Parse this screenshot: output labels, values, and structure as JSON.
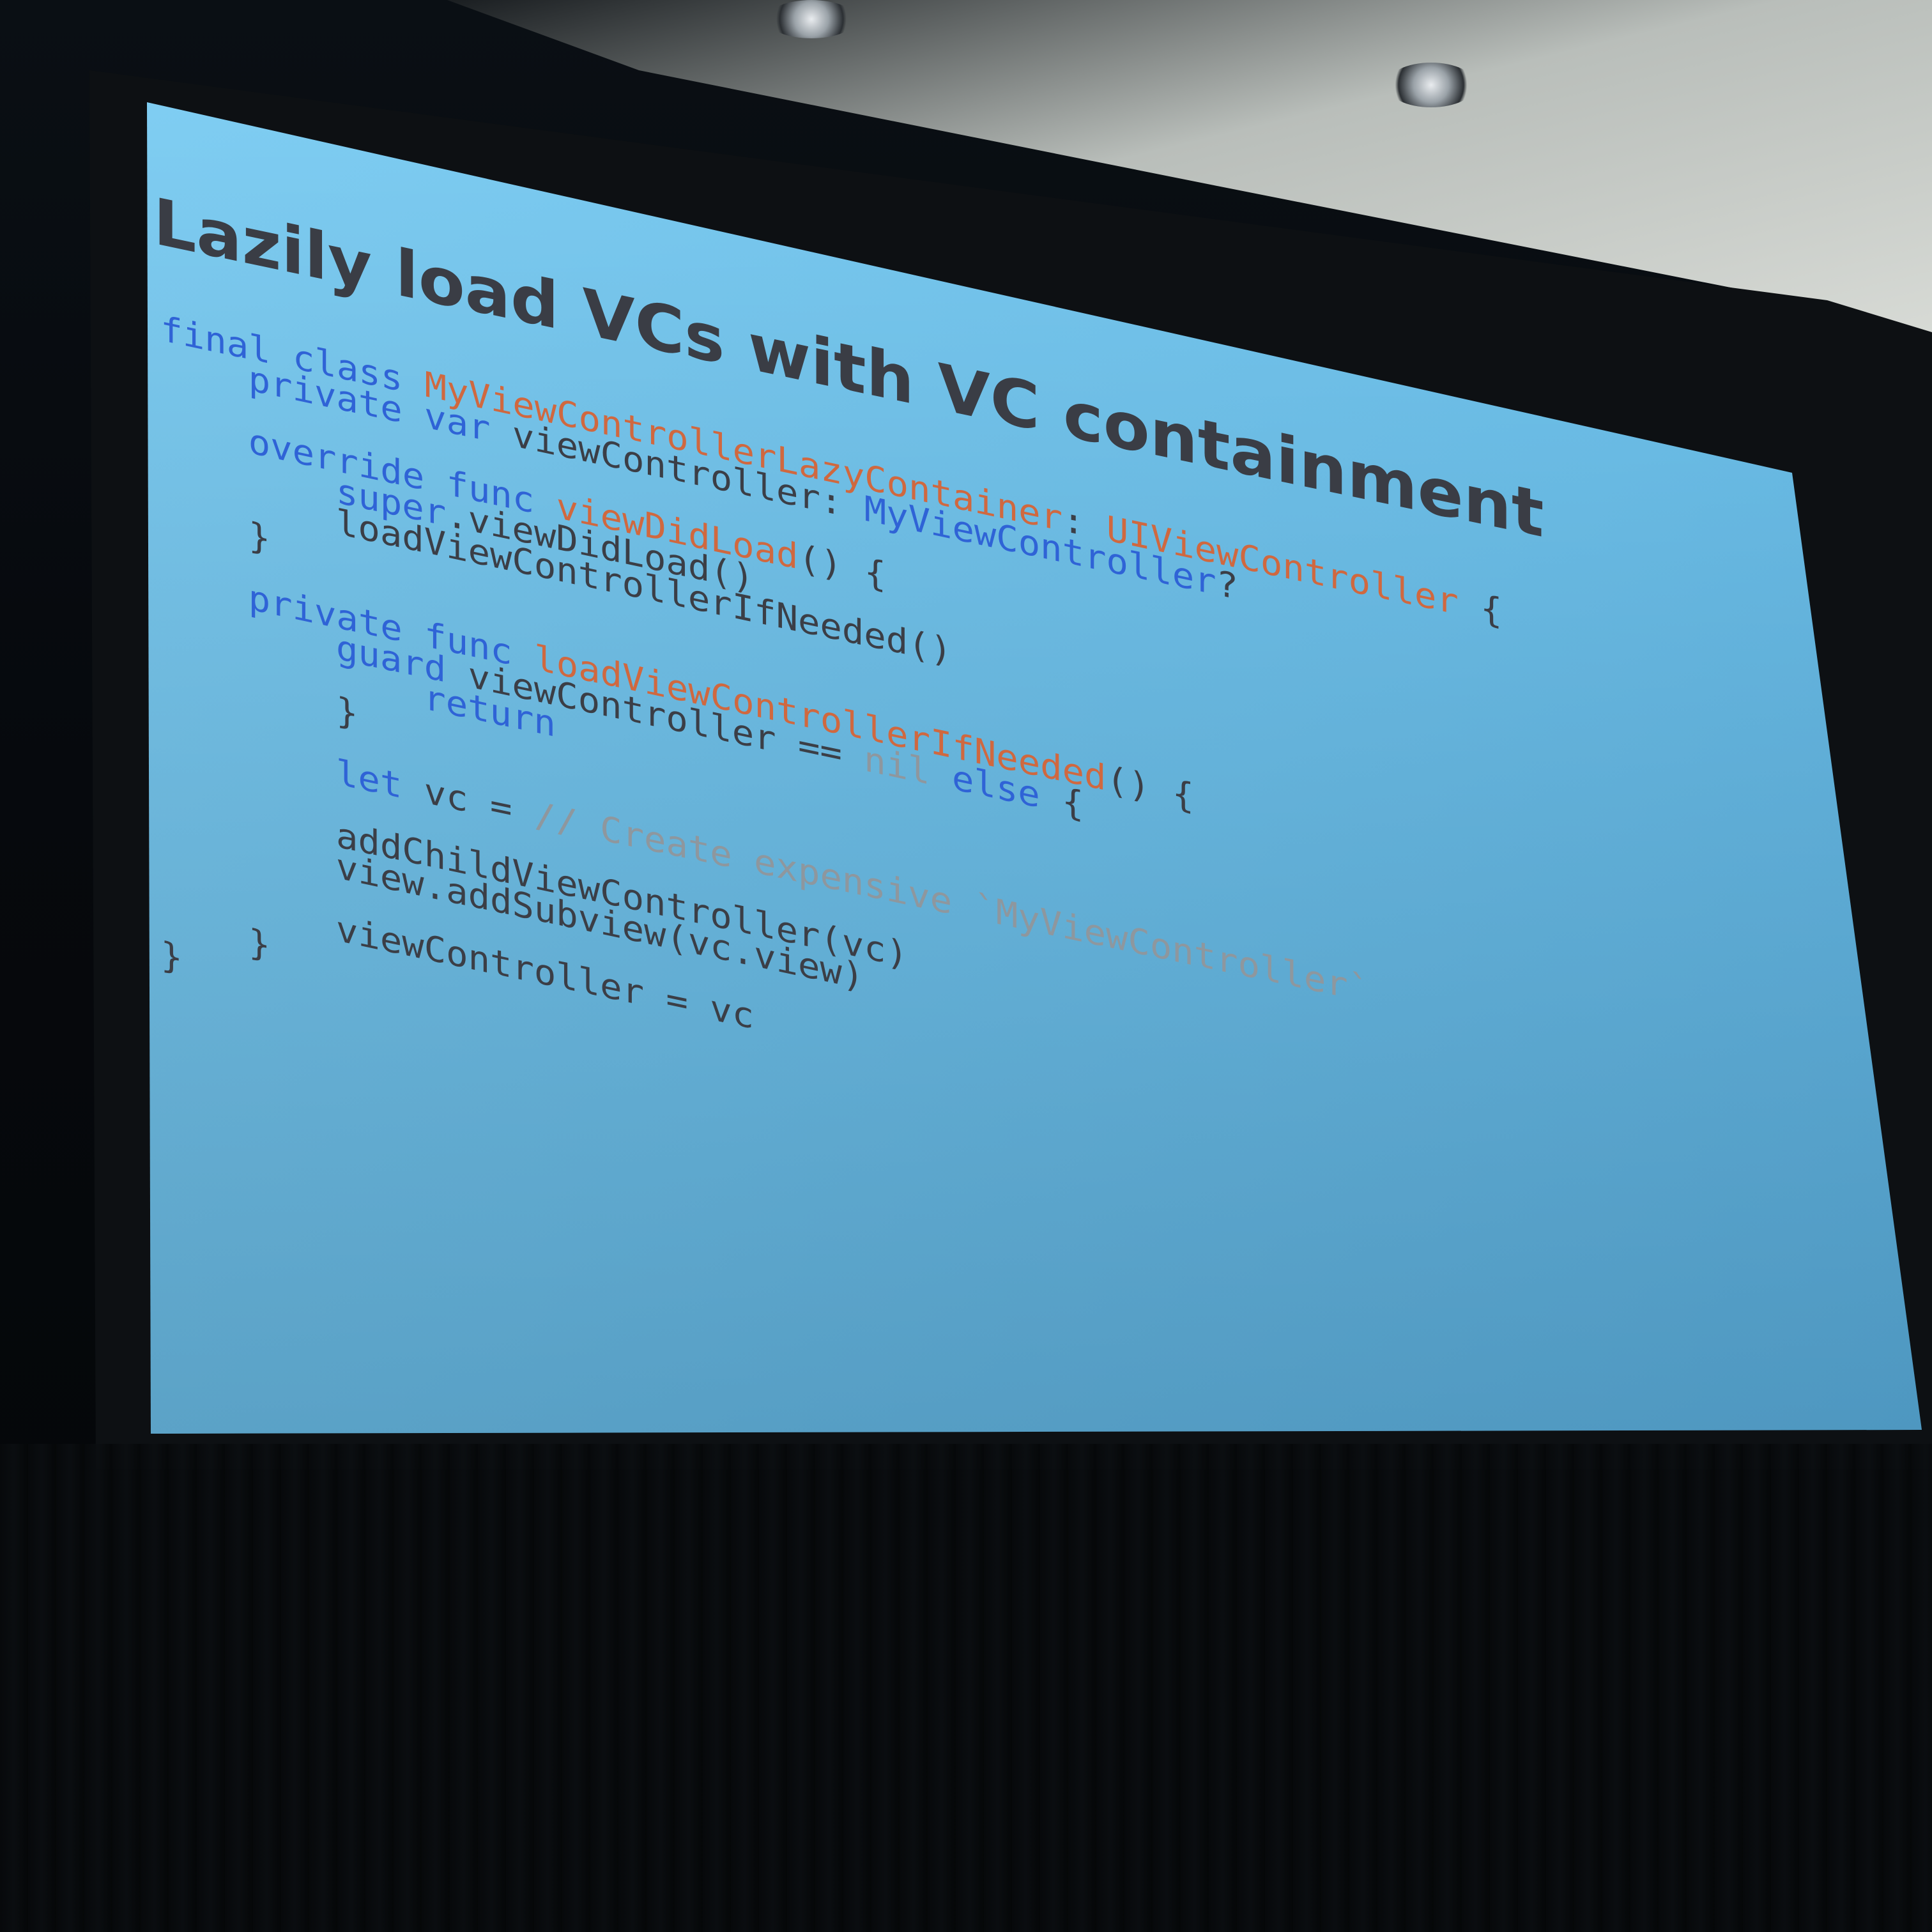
{
  "slide": {
    "title": "Lazily load VCs with VC containment",
    "code_lines": [
      {
        "indent": 0,
        "tokens": [
          {
            "t": "final class ",
            "c": "kw"
          },
          {
            "t": "MyViewControllerLazyContainer",
            "c": "type"
          },
          {
            "t": ": ",
            "c": "plain"
          },
          {
            "t": "UIViewController",
            "c": "type"
          },
          {
            "t": " {",
            "c": "plain"
          }
        ]
      },
      {
        "indent": 1,
        "tokens": [
          {
            "t": "private var ",
            "c": "kw"
          },
          {
            "t": "viewController: ",
            "c": "plain"
          },
          {
            "t": "MyViewController",
            "c": "kw"
          },
          {
            "t": "?",
            "c": "plain"
          }
        ]
      },
      {
        "indent": 0,
        "tokens": []
      },
      {
        "indent": 1,
        "tokens": [
          {
            "t": "override func ",
            "c": "kw"
          },
          {
            "t": "viewDidLoad",
            "c": "type"
          },
          {
            "t": "() {",
            "c": "plain"
          }
        ]
      },
      {
        "indent": 2,
        "tokens": [
          {
            "t": "super",
            "c": "kw"
          },
          {
            "t": ".viewDidLoad()",
            "c": "plain"
          }
        ]
      },
      {
        "indent": 2,
        "tokens": [
          {
            "t": "loadViewControllerIfNeeded()",
            "c": "plain"
          }
        ]
      },
      {
        "indent": 1,
        "tokens": [
          {
            "t": "}",
            "c": "plain"
          }
        ]
      },
      {
        "indent": 0,
        "tokens": []
      },
      {
        "indent": 1,
        "tokens": [
          {
            "t": "private func ",
            "c": "kw"
          },
          {
            "t": "loadViewControllerIfNeeded",
            "c": "type"
          },
          {
            "t": "() {",
            "c": "plain"
          }
        ]
      },
      {
        "indent": 2,
        "tokens": [
          {
            "t": "guard ",
            "c": "kw"
          },
          {
            "t": "viewController == ",
            "c": "plain"
          },
          {
            "t": "nil ",
            "c": "comment"
          },
          {
            "t": "else",
            "c": "kw"
          },
          {
            "t": " {",
            "c": "plain"
          }
        ]
      },
      {
        "indent": 3,
        "tokens": [
          {
            "t": "return",
            "c": "kw"
          }
        ]
      },
      {
        "indent": 2,
        "tokens": [
          {
            "t": "}",
            "c": "plain"
          }
        ]
      },
      {
        "indent": 0,
        "tokens": []
      },
      {
        "indent": 2,
        "tokens": [
          {
            "t": "let ",
            "c": "kw"
          },
          {
            "t": "vc = ",
            "c": "plain"
          },
          {
            "t": "// Create expensive `MyViewController`",
            "c": "comment"
          }
        ]
      },
      {
        "indent": 0,
        "tokens": []
      },
      {
        "indent": 2,
        "tokens": [
          {
            "t": "addChildViewController(vc)",
            "c": "plain"
          }
        ]
      },
      {
        "indent": 2,
        "tokens": [
          {
            "t": "view.addSubview(vc.view)",
            "c": "plain"
          }
        ]
      },
      {
        "indent": 0,
        "tokens": []
      },
      {
        "indent": 2,
        "tokens": [
          {
            "t": "viewController = vc",
            "c": "plain"
          }
        ]
      },
      {
        "indent": 1,
        "tokens": [
          {
            "t": "}",
            "c": "plain"
          }
        ]
      },
      {
        "indent": 0,
        "tokens": [
          {
            "t": "}",
            "c": "plain"
          }
        ]
      }
    ]
  },
  "colors": {
    "slide_bg": "#6ec3ee",
    "title": "#3a3d45",
    "keyword": "#2f63d6",
    "type": "#d0683f",
    "plain": "#3b3e46",
    "comment": "#8e979e",
    "ceiling": "#cfd3d2",
    "screen_border": "#0d1013"
  }
}
